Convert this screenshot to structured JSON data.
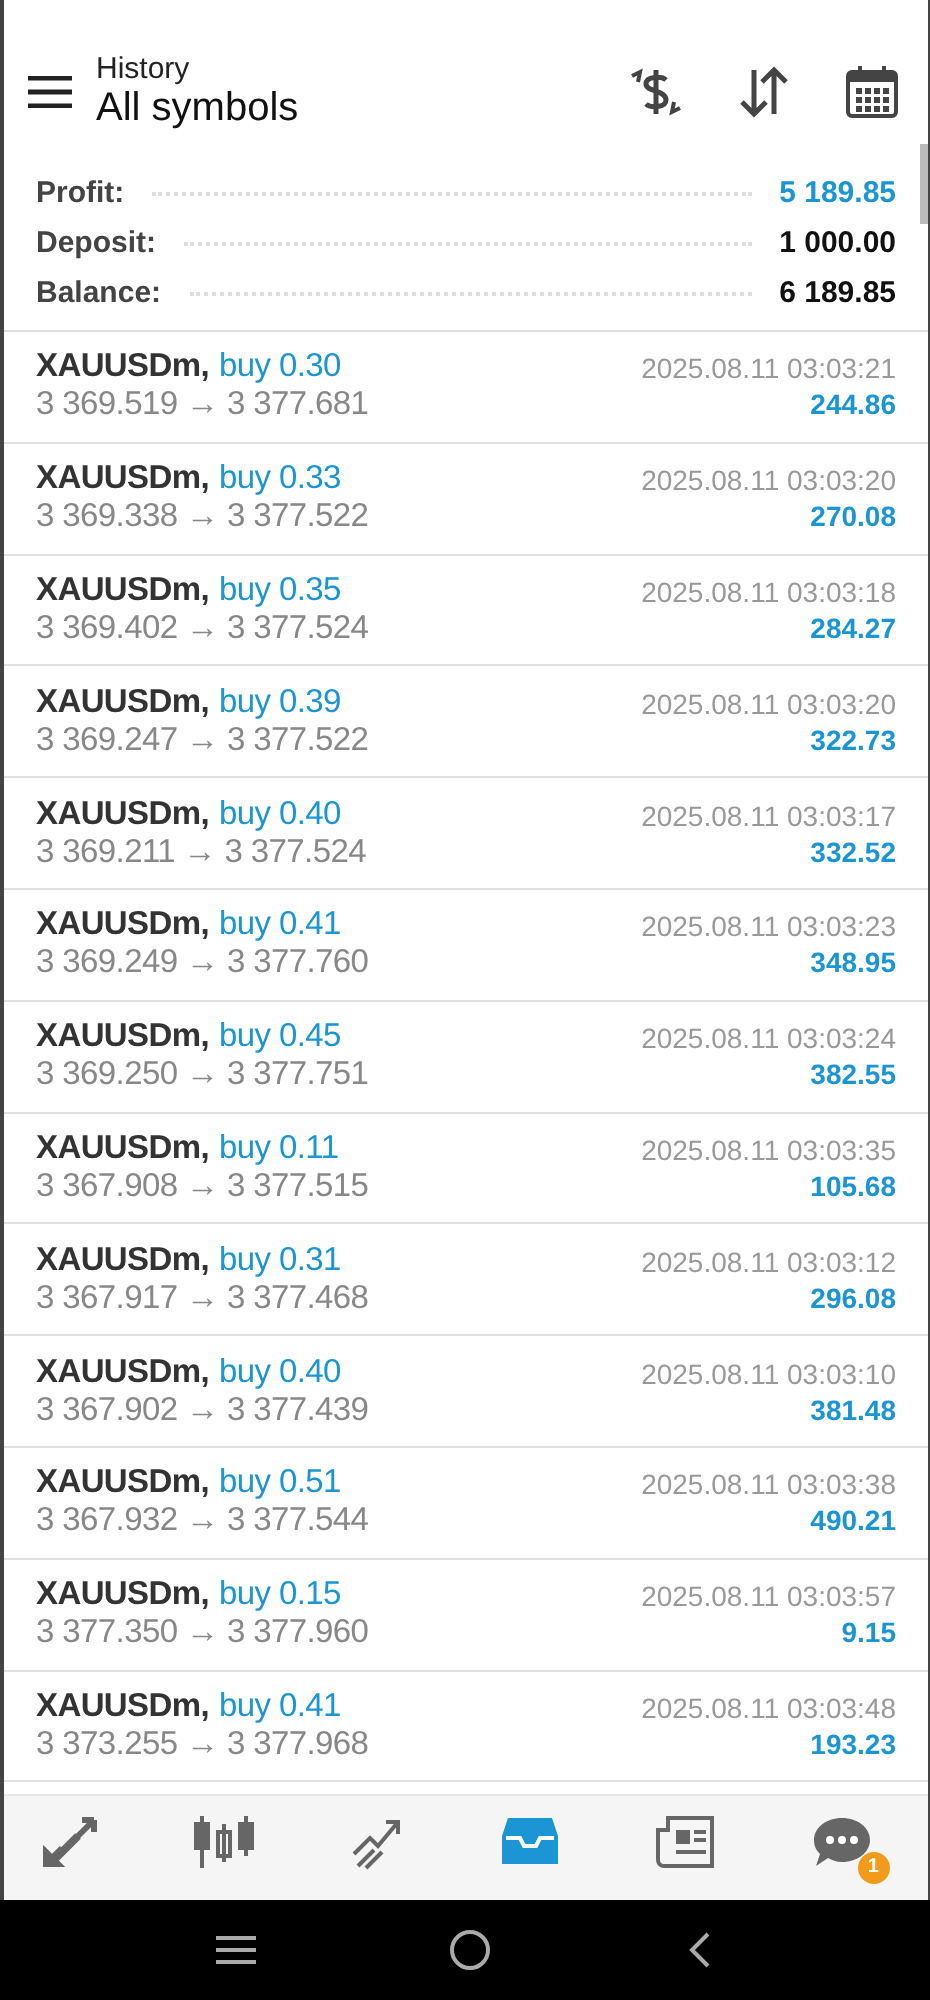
{
  "header": {
    "subtitle": "History",
    "title": "All symbols"
  },
  "summary": [
    {
      "label": "Profit:",
      "value": "5 189.85",
      "kind": "profit"
    },
    {
      "label": "Deposit:",
      "value": "1 000.00",
      "kind": "plain"
    },
    {
      "label": "Balance:",
      "value": "6 189.85",
      "kind": "plain"
    }
  ],
  "deals": [
    {
      "symbol": "XAUUSDm,",
      "side": "buy 0.30",
      "prices": "3 369.519 → 3 377.681",
      "time": "2025.08.11 03:03:21",
      "profit": "244.86"
    },
    {
      "symbol": "XAUUSDm,",
      "side": "buy 0.33",
      "prices": "3 369.338 → 3 377.522",
      "time": "2025.08.11 03:03:20",
      "profit": "270.08"
    },
    {
      "symbol": "XAUUSDm,",
      "side": "buy 0.35",
      "prices": "3 369.402 → 3 377.524",
      "time": "2025.08.11 03:03:18",
      "profit": "284.27"
    },
    {
      "symbol": "XAUUSDm,",
      "side": "buy 0.39",
      "prices": "3 369.247 → 3 377.522",
      "time": "2025.08.11 03:03:20",
      "profit": "322.73"
    },
    {
      "symbol": "XAUUSDm,",
      "side": "buy 0.40",
      "prices": "3 369.211 → 3 377.524",
      "time": "2025.08.11 03:03:17",
      "profit": "332.52"
    },
    {
      "symbol": "XAUUSDm,",
      "side": "buy 0.41",
      "prices": "3 369.249 → 3 377.760",
      "time": "2025.08.11 03:03:23",
      "profit": "348.95"
    },
    {
      "symbol": "XAUUSDm,",
      "side": "buy 0.45",
      "prices": "3 369.250 → 3 377.751",
      "time": "2025.08.11 03:03:24",
      "profit": "382.55"
    },
    {
      "symbol": "XAUUSDm,",
      "side": "buy 0.11",
      "prices": "3 367.908 → 3 377.515",
      "time": "2025.08.11 03:03:35",
      "profit": "105.68"
    },
    {
      "symbol": "XAUUSDm,",
      "side": "buy 0.31",
      "prices": "3 367.917 → 3 377.468",
      "time": "2025.08.11 03:03:12",
      "profit": "296.08"
    },
    {
      "symbol": "XAUUSDm,",
      "side": "buy 0.40",
      "prices": "3 367.902 → 3 377.439",
      "time": "2025.08.11 03:03:10",
      "profit": "381.48"
    },
    {
      "symbol": "XAUUSDm,",
      "side": "buy 0.51",
      "prices": "3 367.932 → 3 377.544",
      "time": "2025.08.11 03:03:38",
      "profit": "490.21"
    },
    {
      "symbol": "XAUUSDm,",
      "side": "buy 0.15",
      "prices": "3 377.350 → 3 377.960",
      "time": "2025.08.11 03:03:57",
      "profit": "9.15"
    },
    {
      "symbol": "XAUUSDm,",
      "side": "buy 0.41",
      "prices": "3 373.255 → 3 377.968",
      "time": "2025.08.11 03:03:48",
      "profit": "193.23"
    }
  ],
  "bottom_nav": [
    {
      "kind": "quotes",
      "selected": false
    },
    {
      "kind": "chart",
      "selected": false
    },
    {
      "kind": "trade",
      "selected": false
    },
    {
      "kind": "history",
      "selected": true
    },
    {
      "kind": "news",
      "selected": false
    },
    {
      "kind": "messages",
      "selected": false,
      "badge": "1"
    }
  ]
}
